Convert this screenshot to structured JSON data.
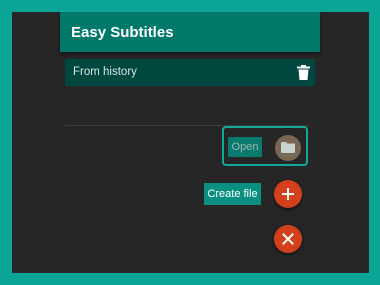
{
  "header": {
    "title": "Easy Subtitles"
  },
  "history": {
    "label": "From history",
    "delete_icon": "trash-icon"
  },
  "fab_menu": {
    "open_label": "Open",
    "open_icon": "folder-icon",
    "create_label": "Create file",
    "create_icon": "plus-icon",
    "close_icon": "close-icon"
  },
  "colors": {
    "frame": "#0aa597",
    "background": "#262626",
    "header": "#00796b",
    "history_row": "#00483f",
    "fab": "#d4401d",
    "label_bg": "#0a8f82"
  }
}
